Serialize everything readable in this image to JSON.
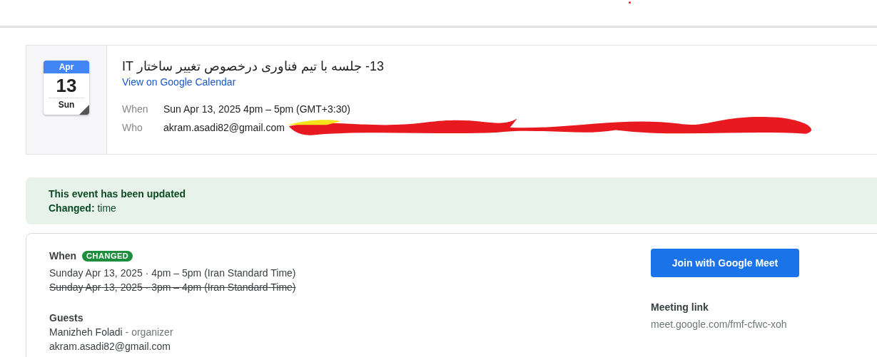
{
  "summary": {
    "month": "Apr",
    "day": "13",
    "weekday": "Sun",
    "title": "13- جلسه با تیم فناوری درخصوص تغییر ساختار IT",
    "calendar_link": "View on Google Calendar",
    "fields": [
      {
        "label": "When",
        "value": "Sun Apr 13, 2025 4pm – 5pm (GMT+3:30)"
      },
      {
        "label": "Who",
        "value": "akram.asadi82@gmail.com",
        "redacted": true
      }
    ]
  },
  "banner": {
    "heading": "This event has been updated",
    "change": "**Changed:** time"
  },
  "details": {
    "when_label": "When",
    "badge": "CHANGED",
    "times": [
      {
        "text": "Sunday Apr 13, 2025 · 4pm – 5pm (Iran Standard Time)",
        "struck": false
      },
      {
        "text": "Sunday Apr 13, 2025 · 3pm – 4pm (Iran Standard Time)",
        "struck": true
      }
    ],
    "guests_label": "Guests",
    "guests": [
      {
        "name": "Manizheh Foladi",
        "role": "- organizer"
      },
      {
        "name": "akram.asadi82@gmail.com"
      }
    ],
    "join_button": "Join with Google Meet",
    "meeting_label": "Meeting link",
    "meeting_url": "meet.google.com/fmf-cfwc-xoh"
  }
}
